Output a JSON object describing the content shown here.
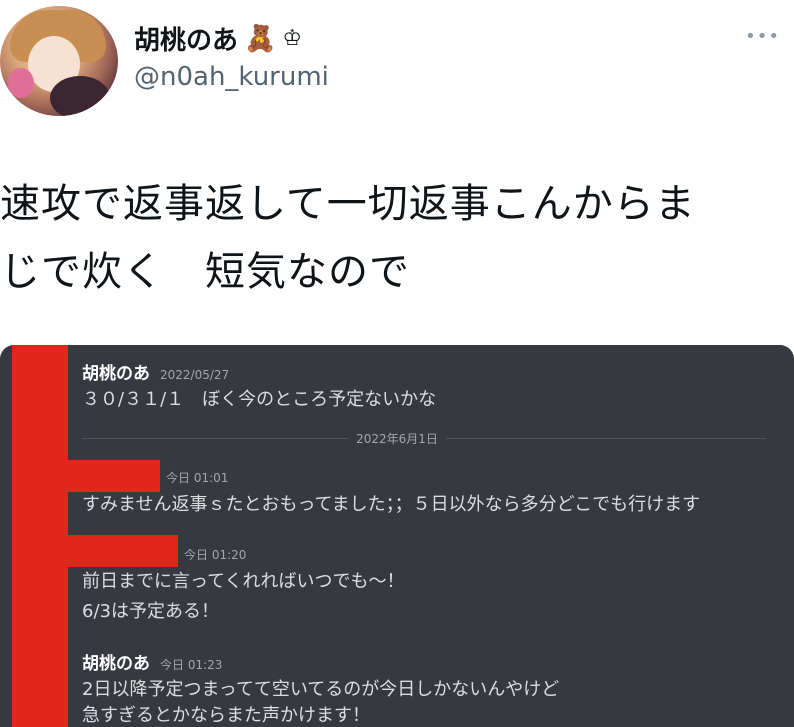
{
  "profile": {
    "display_name": "胡桃のあ",
    "name_emoji": "🧸",
    "name_symbol": "♔",
    "handle": "@n0ah_kurumi",
    "more": "•••"
  },
  "tweet": {
    "lines": [
      "速攻で返事返して一切返事こんからま",
      "じで炊く　短気なので"
    ]
  },
  "embed": {
    "date_divider": "2022年6月1日",
    "messages": [
      {
        "author": "胡桃のあ",
        "time": "2022/05/27",
        "text": "３０/３１/１　ぼく今のところ予定ないかな"
      },
      {
        "author": "",
        "time": "今日 01:01",
        "text": "すみません返事ｓたとおもってました；；５日以外なら多分どこでも行けます"
      },
      {
        "author": "",
        "time": "今日 01:20",
        "text": "前日までに言ってくれればいつでも〜！"
      },
      {
        "author": "",
        "time": "",
        "text": "6/3は予定ある！"
      },
      {
        "author": "胡桃のあ",
        "time": "今日 01:23",
        "text": "2日以降予定つまってて空いてるのが今日しかないんやけど"
      },
      {
        "author": "",
        "time": "",
        "text": "急すぎるとかならまた声かけます！"
      }
    ]
  },
  "colors": {
    "chat_bg": "#36393f",
    "redaction": "#e0271c",
    "handle": "#536471"
  }
}
